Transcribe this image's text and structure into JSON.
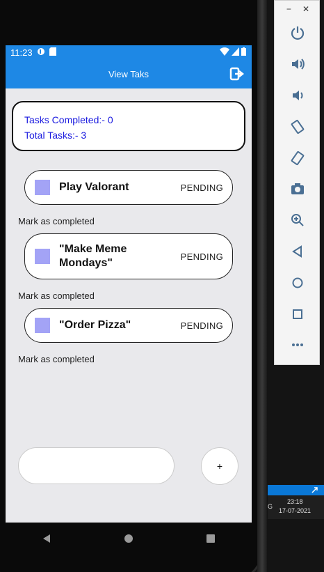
{
  "status_bar": {
    "time": "11:23"
  },
  "app_bar": {
    "title": "View Taks"
  },
  "summary": {
    "completed_text": "Tasks Completed:- 0",
    "total_text": "Total Tasks:- 3"
  },
  "tasks": [
    {
      "title": "Play Valorant",
      "status": "PENDING",
      "action": "Mark as completed"
    },
    {
      "title": "\"Make Meme Mondays\"",
      "status": "PENDING",
      "action": "Mark as completed"
    },
    {
      "title": "\"Order Pizza\"",
      "status": "PENDING",
      "action": "Mark as completed"
    }
  ],
  "add_button": {
    "label": "+"
  },
  "emulator": {
    "window_controls": [
      "−",
      "✕"
    ],
    "tools": [
      "power-icon",
      "volume-up-icon",
      "volume-down-icon",
      "rotate-left-icon",
      "rotate-right-icon",
      "camera-icon",
      "zoom-icon",
      "back-icon",
      "home-icon",
      "overview-icon",
      "more-icon"
    ]
  },
  "taskbar": {
    "time": "23:18",
    "date": "17-07-2021",
    "left_char": "G"
  },
  "colors": {
    "app_blue": "#1e88e5",
    "checkbox": "#a3a3f6",
    "summary_text": "#1a1adf"
  }
}
